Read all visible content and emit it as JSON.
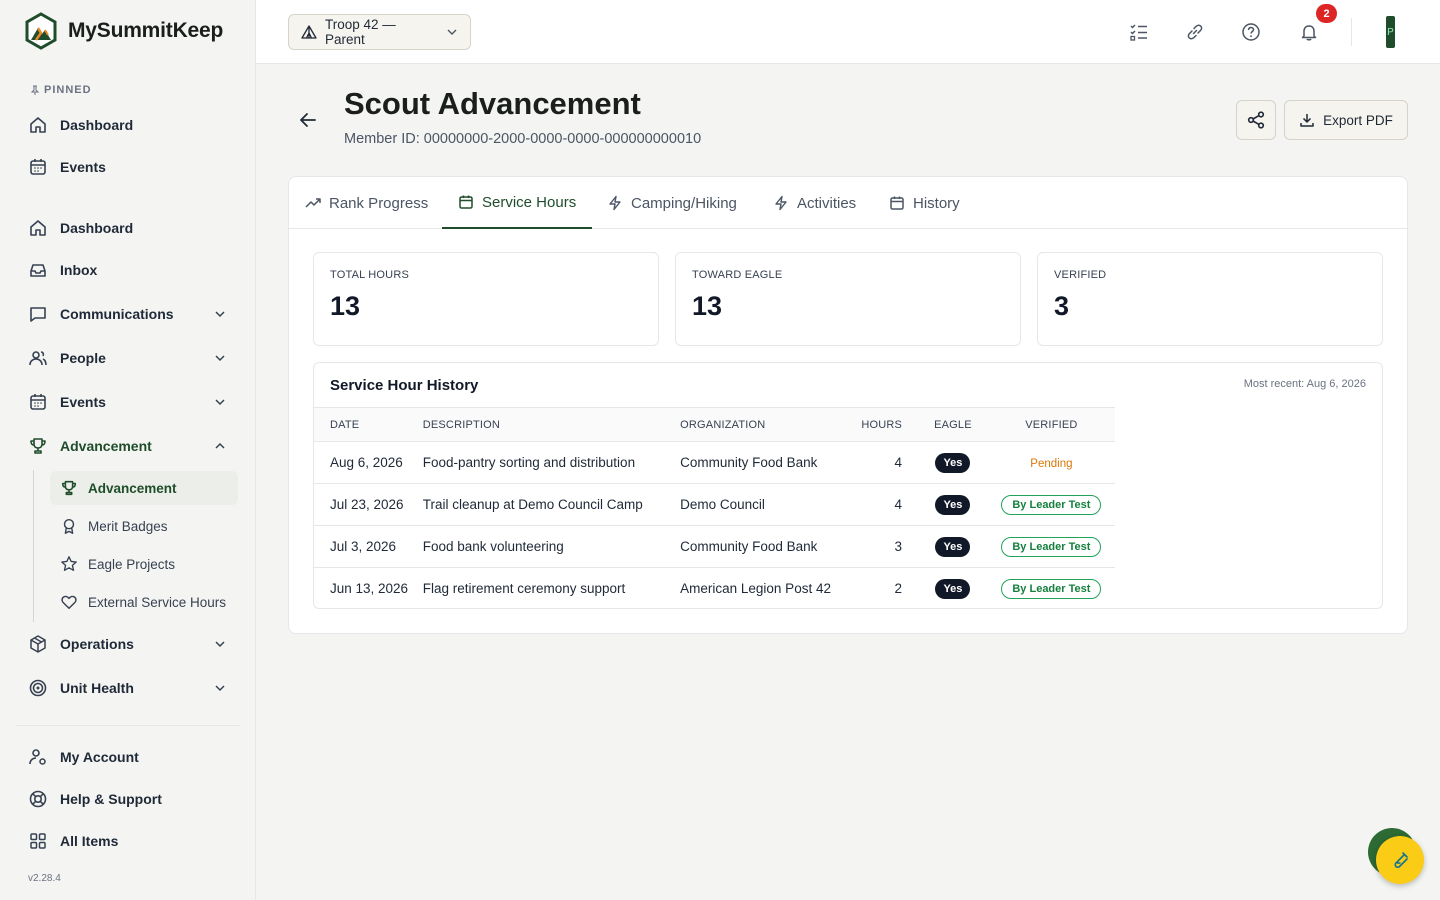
{
  "brand": {
    "name": "MySummitKeep"
  },
  "sidebar": {
    "pinned_label": "PINNED",
    "pinned": [
      {
        "label": "Dashboard",
        "icon": "home-icon"
      },
      {
        "label": "Events",
        "icon": "calendar-icon"
      }
    ],
    "items": [
      {
        "label": "Dashboard",
        "icon": "home-icon"
      },
      {
        "label": "Inbox",
        "icon": "inbox-icon"
      },
      {
        "label": "Communications",
        "icon": "chat-icon"
      },
      {
        "label": "People",
        "icon": "people-icon"
      },
      {
        "label": "Events",
        "icon": "calendar-icon"
      },
      {
        "label": "Advancement",
        "icon": "trophy-icon"
      }
    ],
    "advancement_sub": [
      {
        "label": "Advancement",
        "icon": "trophy-icon",
        "active": true
      },
      {
        "label": "Merit Badges",
        "icon": "badge-icon"
      },
      {
        "label": "Eagle Projects",
        "icon": "star-icon"
      },
      {
        "label": "External Service Hours",
        "icon": "heart-icon"
      }
    ],
    "more_items": [
      {
        "label": "Operations",
        "icon": "box-icon"
      },
      {
        "label": "Unit Health",
        "icon": "target-icon"
      }
    ],
    "footer_items": [
      {
        "label": "My Account",
        "icon": "user-gear-icon"
      },
      {
        "label": "Help & Support",
        "icon": "lifebuoy-icon"
      },
      {
        "label": "All Items",
        "icon": "grid-icon"
      }
    ],
    "version": "v2.28.4"
  },
  "topbar": {
    "troop_select": "Troop 42 — Parent",
    "notification_count": "2",
    "avatar_initial": "P"
  },
  "page": {
    "title": "Scout Advancement",
    "member_id": "Member ID: 00000000-2000-0000-0000-000000000010",
    "export_label": "Export PDF"
  },
  "tabs": [
    {
      "label": "Rank Progress",
      "icon": "trend-icon"
    },
    {
      "label": "Service Hours",
      "icon": "calendar-icon",
      "active": true
    },
    {
      "label": "Camping/Hiking",
      "icon": "bolt-icon"
    },
    {
      "label": "Activities",
      "icon": "bolt-icon"
    },
    {
      "label": "History",
      "icon": "calendar-icon"
    }
  ],
  "stats": [
    {
      "label": "TOTAL HOURS",
      "value": "13"
    },
    {
      "label": "TOWARD EAGLE",
      "value": "13"
    },
    {
      "label": "VERIFIED",
      "value": "3"
    }
  ],
  "history": {
    "title": "Service Hour History",
    "most_recent": "Most recent: Aug 6, 2026",
    "columns": [
      "DATE",
      "DESCRIPTION",
      "ORGANIZATION",
      "HOURS",
      "EAGLE",
      "VERIFIED"
    ],
    "rows": [
      {
        "date": "Aug 6, 2026",
        "description": "Food-pantry sorting and distribution",
        "organization": "Community Food Bank",
        "hours": "4",
        "eagle": "Yes",
        "verified": "Pending",
        "status": "pending"
      },
      {
        "date": "Jul 23, 2026",
        "description": "Trail cleanup at Demo Council Camp",
        "organization": "Demo Council",
        "hours": "4",
        "eagle": "Yes",
        "verified": "By Leader Test",
        "status": "verified"
      },
      {
        "date": "Jul 3, 2026",
        "description": "Food bank volunteering",
        "organization": "Community Food Bank",
        "hours": "3",
        "eagle": "Yes",
        "verified": "By Leader Test",
        "status": "verified"
      },
      {
        "date": "Jun 13, 2026",
        "description": "Flag retirement ceremony support",
        "organization": "American Legion Post 42",
        "hours": "2",
        "eagle": "Yes",
        "verified": "By Leader Test",
        "status": "verified"
      }
    ]
  },
  "colors": {
    "brand_green": "#1f4d2b",
    "notification_red": "#dc2626",
    "pending_orange": "#d97706",
    "verified_green": "#15803d",
    "fab_yellow": "#facc15"
  }
}
